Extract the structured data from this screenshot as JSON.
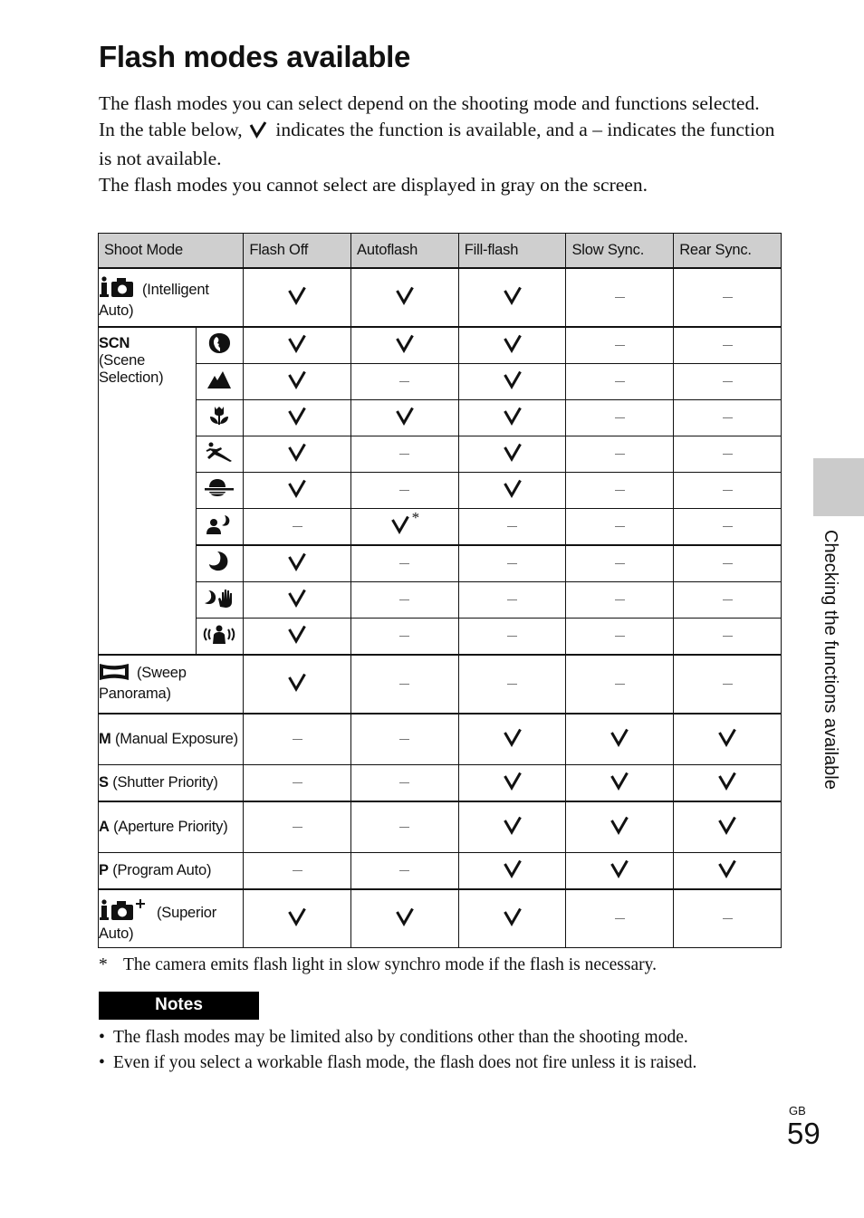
{
  "page": {
    "title": "Flash modes available",
    "intro": [
      "The flash modes you can select depend on the shooting mode and functions selected.",
      {
        "before": "In the table below,",
        "symbol": "check-icon",
        "after": "indicates the function is available, and a – indicates the function is not available."
      },
      "The flash modes you cannot select are displayed in gray on the screen."
    ],
    "intro_line1": "The flash modes you can select depend on the shooting mode and functions selected.",
    "intro_line2_before": "In the table below,",
    "intro_line2_after": "indicates the function is available, and a – indicates the function is not available.",
    "intro_line3": "The flash modes you cannot select are displayed in gray on the screen."
  },
  "table": {
    "headers": [
      "Shoot Mode",
      "Flash Off",
      "Autoflash",
      "Fill-flash",
      "Slow Sync.",
      "Rear Sync."
    ],
    "legend": {
      "check": "available",
      "dash": "not available",
      "check_star": "available (see footnote)"
    },
    "rows": [
      {
        "icon": "intelligent-auto-icon",
        "letter": "",
        "label": "(Intelligent Auto)",
        "values": [
          "check",
          "check",
          "check",
          "dash",
          "dash"
        ]
      },
      {
        "group": "SCN",
        "group_label": "(Scene Selection)",
        "scenes": [
          {
            "icon": "portrait-icon",
            "name": "Portrait",
            "values": [
              "check",
              "check",
              "check",
              "dash",
              "dash"
            ]
          },
          {
            "icon": "landscape-icon",
            "name": "Landscape",
            "values": [
              "check",
              "dash",
              "check",
              "dash",
              "dash"
            ]
          },
          {
            "icon": "macro-icon",
            "name": "Macro",
            "values": [
              "check",
              "check",
              "check",
              "dash",
              "dash"
            ]
          },
          {
            "icon": "sports-icon",
            "name": "Sports Action",
            "values": [
              "check",
              "dash",
              "check",
              "dash",
              "dash"
            ]
          },
          {
            "icon": "sunset-icon",
            "name": "Sunset",
            "values": [
              "check",
              "dash",
              "check",
              "dash",
              "dash"
            ]
          },
          {
            "icon": "night-portrait-icon",
            "name": "Night Portrait",
            "values": [
              "dash",
              "check*",
              "dash",
              "dash",
              "dash"
            ]
          },
          {
            "icon": "night-scene-icon",
            "name": "Night Scene",
            "values": [
              "check",
              "dash",
              "dash",
              "dash",
              "dash"
            ]
          },
          {
            "icon": "hand-held-twilight-icon",
            "name": "Hand-held Twilight",
            "values": [
              "check",
              "dash",
              "dash",
              "dash",
              "dash"
            ]
          },
          {
            "icon": "anti-motion-blur-icon",
            "name": "Anti Motion Blur",
            "values": [
              "check",
              "dash",
              "dash",
              "dash",
              "dash"
            ]
          }
        ]
      },
      {
        "icon": "sweep-panorama-icon",
        "letter": "",
        "label": "(Sweep Panorama)",
        "values": [
          "check",
          "dash",
          "dash",
          "dash",
          "dash"
        ]
      },
      {
        "icon": "",
        "letter": "M",
        "label": "(Manual Exposure)",
        "values": [
          "dash",
          "dash",
          "check",
          "check",
          "check"
        ]
      },
      {
        "icon": "",
        "letter": "S",
        "label": "(Shutter Priority)",
        "values": [
          "dash",
          "dash",
          "check",
          "check",
          "check"
        ]
      },
      {
        "icon": "",
        "letter": "A",
        "label": "(Aperture Priority)",
        "values": [
          "dash",
          "dash",
          "check",
          "check",
          "check"
        ]
      },
      {
        "icon": "",
        "letter": "P",
        "label": "(Program Auto)",
        "values": [
          "dash",
          "dash",
          "check",
          "check",
          "check"
        ]
      },
      {
        "icon": "superior-auto-icon",
        "letter": "",
        "label": "(Superior Auto)",
        "values": [
          "check",
          "check",
          "check",
          "dash",
          "dash"
        ]
      }
    ],
    "scn_letter": "SCN",
    "scn_label": "(Scene Selection)",
    "labels": {
      "intelligent_auto": "(Intelligent Auto)",
      "sweep": "(Sweep Panorama)",
      "m_letter": "M",
      "m_label": "(Manual Exposure)",
      "s_letter": "S",
      "s_label": "(Shutter Priority)",
      "a_letter": "A",
      "a_label": "(Aperture Priority)",
      "p_letter": "P",
      "p_label": "(Program Auto)",
      "superior_auto": "(Superior Auto)"
    },
    "star": "*"
  },
  "footnote": {
    "marker": "*",
    "text": "The camera emits flash light in slow synchro mode if the flash is necessary."
  },
  "notes": {
    "title": "Notes",
    "items": [
      "The flash modes may be limited also by conditions other than the shooting mode.",
      "Even if you select a workable flash mode, the flash does not fire unless it is raised."
    ]
  },
  "side": {
    "section_label": "Checking the functions available",
    "tab_color": "#cbcbcb"
  },
  "footer": {
    "language": "GB",
    "page_number": "59"
  }
}
